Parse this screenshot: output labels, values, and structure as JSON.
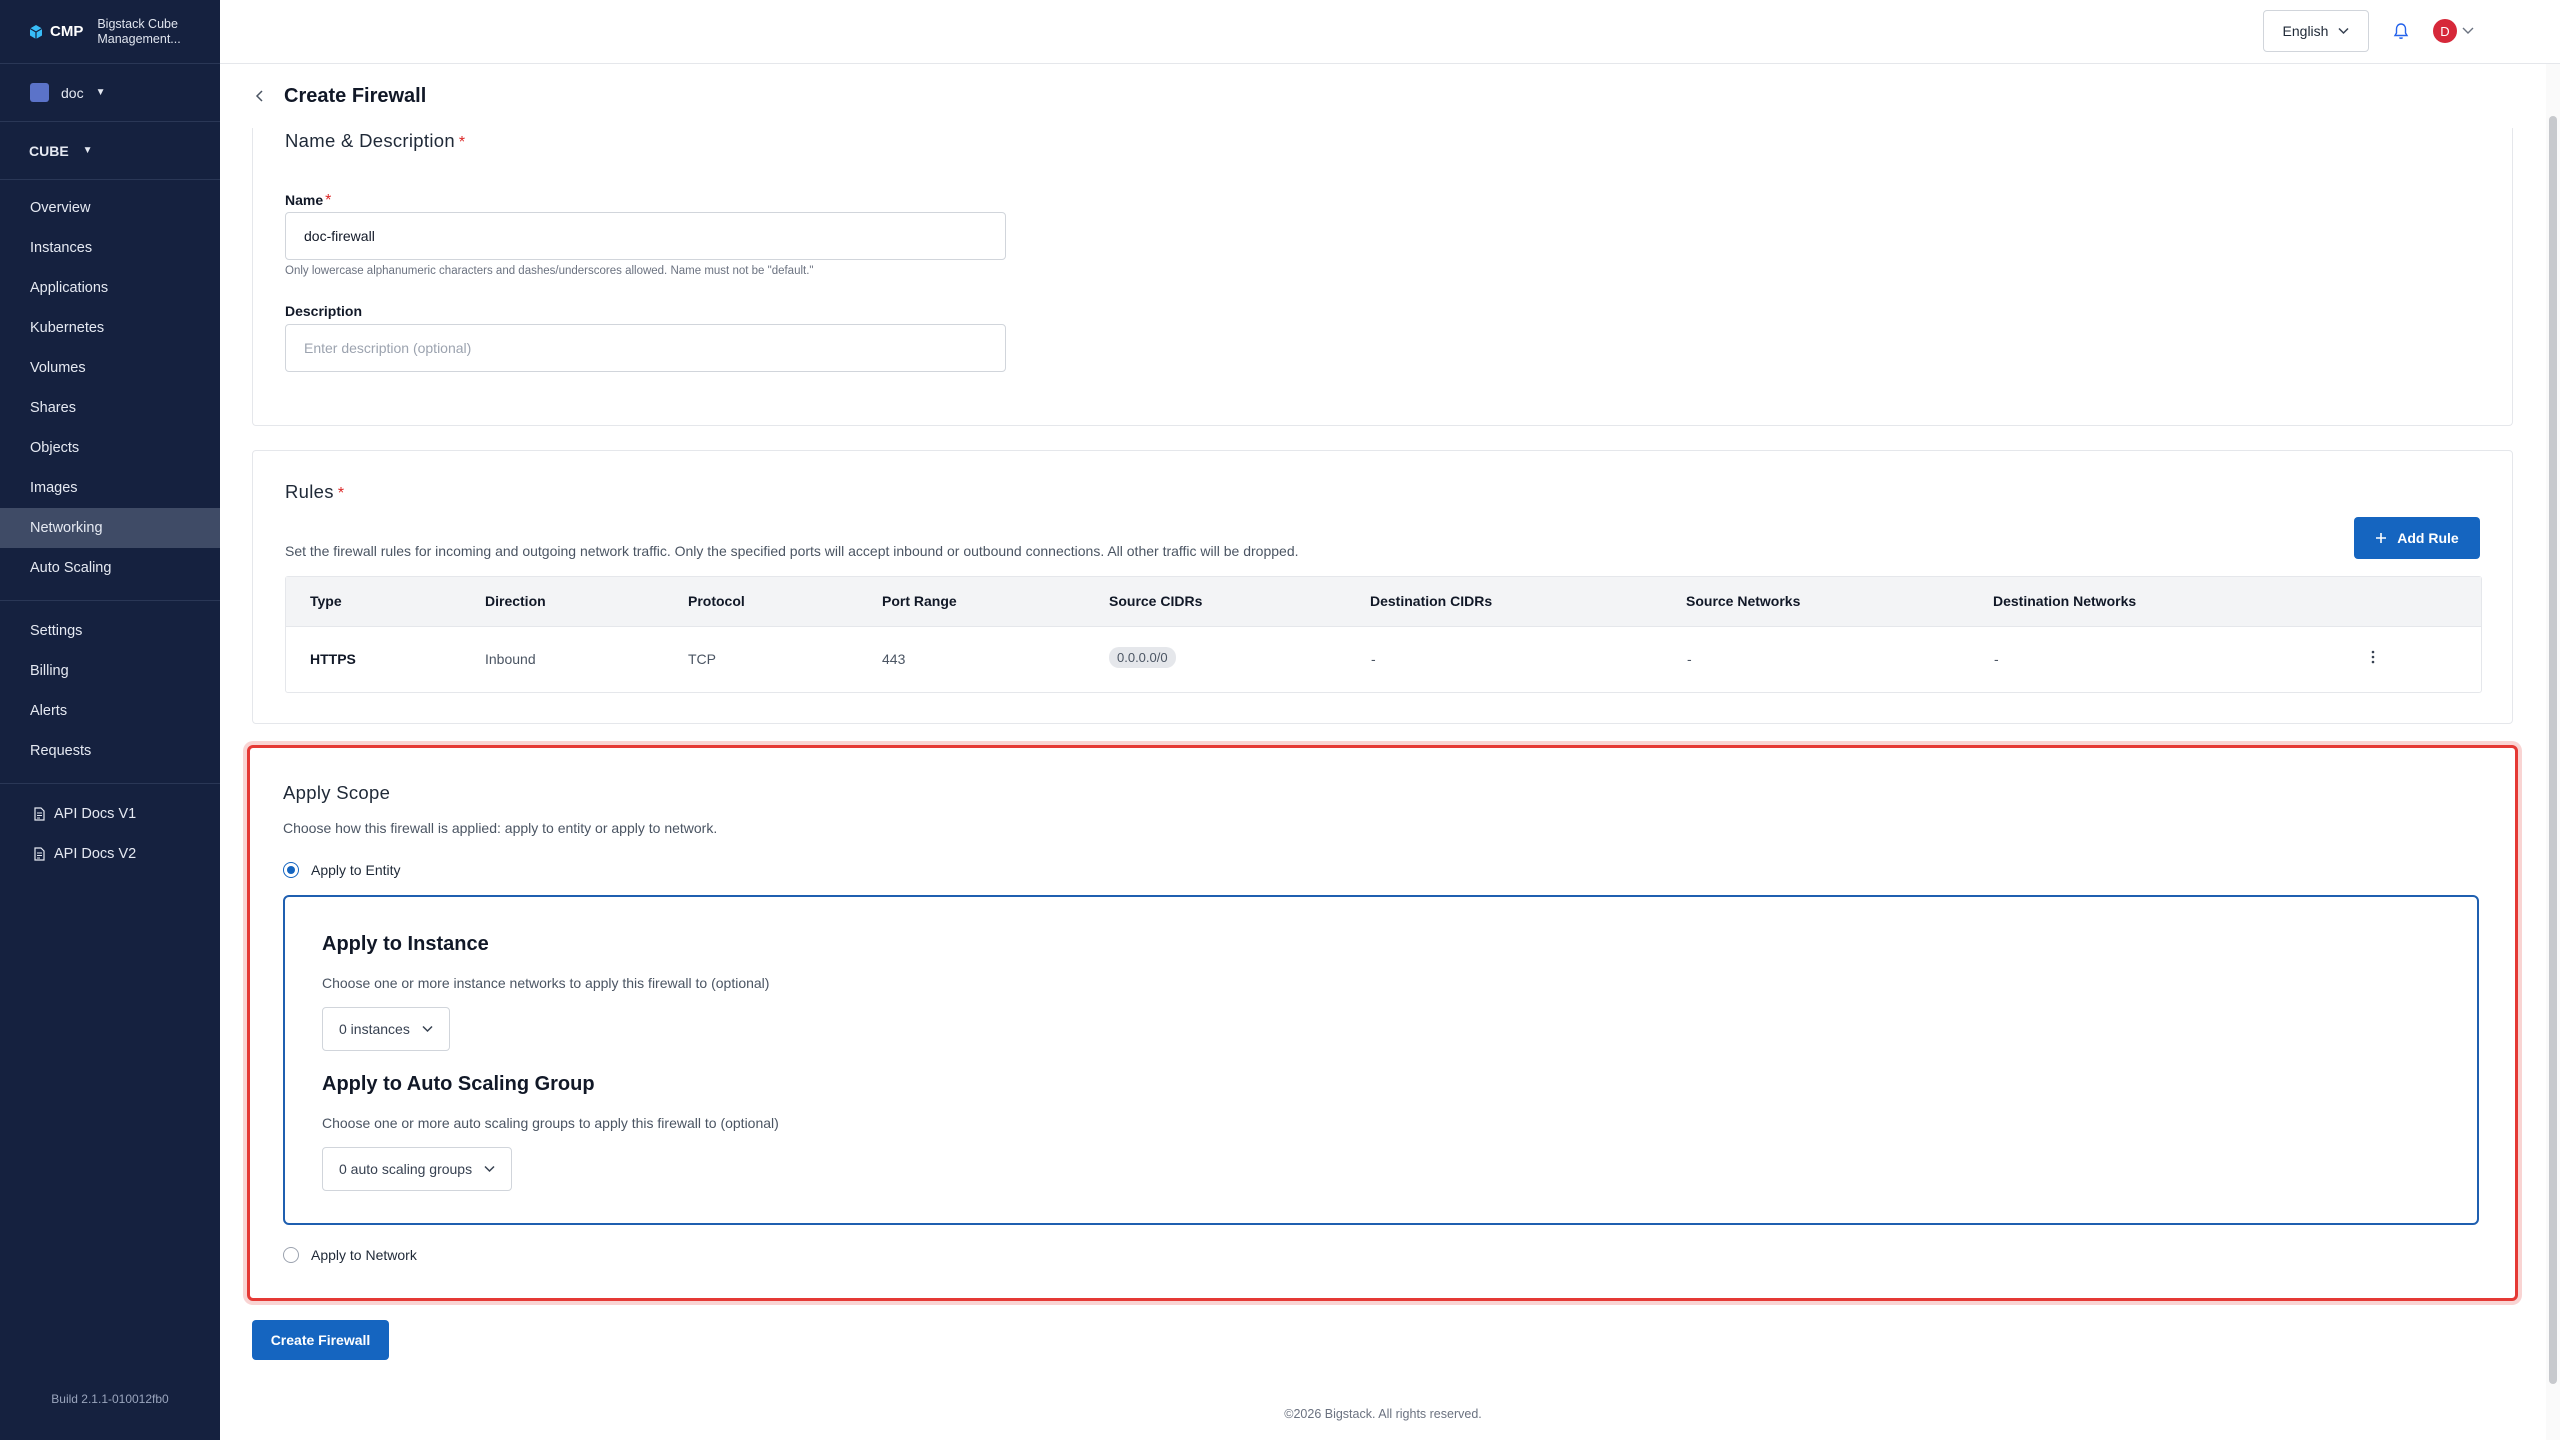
{
  "brand": {
    "logo_text": "CMP",
    "name": "Bigstack Cube Management..."
  },
  "project": {
    "name": "doc"
  },
  "service": {
    "name": "CUBE"
  },
  "nav": {
    "main": [
      "Overview",
      "Instances",
      "Applications",
      "Kubernetes",
      "Volumes",
      "Shares",
      "Objects",
      "Images",
      "Networking",
      "Auto Scaling"
    ],
    "active": "Networking",
    "secondary": [
      "Settings",
      "Billing",
      "Alerts",
      "Requests"
    ],
    "docs": [
      "API Docs V1",
      "API Docs V2"
    ]
  },
  "build": "Build 2.1.1-010012fb0",
  "topbar": {
    "language": "English",
    "avatar_initial": "D"
  },
  "page": {
    "title": "Create Firewall"
  },
  "name_desc": {
    "title": "Name & Description",
    "required_mark": "*",
    "name_label": "Name",
    "name_value": "doc-firewall",
    "name_hint": "Only lowercase alphanumeric characters and dashes/underscores allowed. Name must not be \"default.\"",
    "description_label": "Description",
    "description_placeholder": "Enter description (optional)"
  },
  "rules": {
    "title": "Rules",
    "description": "Set the firewall rules for incoming and outgoing network traffic. Only the specified ports will accept inbound or outbound connections. All other traffic will be dropped.",
    "add_label": "Add Rule",
    "columns": [
      "Type",
      "Direction",
      "Protocol",
      "Port Range",
      "Source CIDRs",
      "Destination CIDRs",
      "Source Networks",
      "Destination Networks"
    ],
    "rows": [
      {
        "type": "HTTPS",
        "direction": "Inbound",
        "protocol": "TCP",
        "port_range": "443",
        "source_cidrs": "0.0.0.0/0",
        "destination_cidrs": "-",
        "source_networks": "-",
        "destination_networks": "-"
      }
    ]
  },
  "scope": {
    "title": "Apply Scope",
    "description": "Choose how this firewall is applied: apply to entity or apply to network.",
    "option_entity": "Apply to Entity",
    "option_network": "Apply to Network",
    "selected": "entity",
    "instance_title": "Apply to Instance",
    "instance_desc": "Choose one or more instance networks to apply this firewall to (optional)",
    "instance_dropdown": "0 instances",
    "asg_title": "Apply to Auto Scaling Group",
    "asg_desc": "Choose one or more auto scaling groups to apply this firewall to (optional)",
    "asg_dropdown": "0 auto scaling groups"
  },
  "actions": {
    "create_label": "Create Firewall"
  },
  "footer": "©2026 Bigstack. All rights reserved.",
  "colors": {
    "sidebar_bg": "#15213f",
    "primary": "#1565c0",
    "highlight_border": "#e53935",
    "required": "#dc2626",
    "avatar": "#d62839"
  }
}
